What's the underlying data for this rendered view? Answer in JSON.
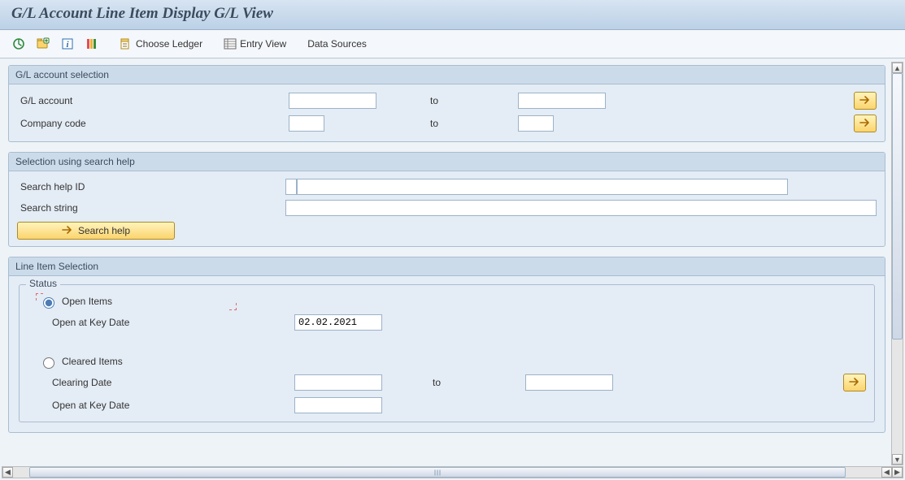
{
  "title": "G/L Account Line Item Display G/L View",
  "toolbar": {
    "choose_ledger": "Choose Ledger",
    "entry_view": "Entry View",
    "data_sources": "Data Sources"
  },
  "glsel": {
    "title": "G/L account selection",
    "gl_account_label": "G/L account",
    "gl_account_from": "",
    "gl_account_to": "",
    "company_code_label": "Company code",
    "company_code_from": "",
    "company_code_to": "",
    "to_label": "to"
  },
  "search": {
    "title": "Selection using search help",
    "help_id_label": "Search help ID",
    "help_id_key": "",
    "help_id_desc": "",
    "string_label": "Search string",
    "string_value": "",
    "button_label": "Search help"
  },
  "lineitem": {
    "title": "Line Item Selection",
    "status_title": "Status",
    "open_items_label": "Open Items",
    "open_at_key_date_label": "Open at Key Date",
    "open_at_key_date_value": "02.02.2021",
    "cleared_items_label": "Cleared Items",
    "clearing_date_label": "Clearing Date",
    "clearing_date_from": "",
    "clearing_date_to": "",
    "cleared_open_key_date_label": "Open at Key Date",
    "cleared_open_key_date_value": "",
    "to_label": "to"
  }
}
